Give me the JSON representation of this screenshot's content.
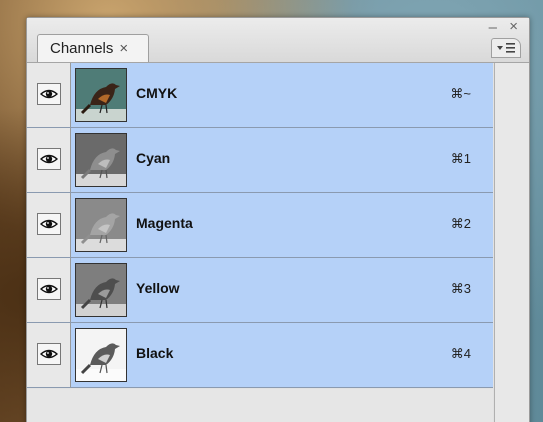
{
  "panel": {
    "tab_label": "Channels",
    "tab_close_glyph": "×",
    "minimize_glyph": "–",
    "close_glyph": "×"
  },
  "channels": [
    {
      "name": "CMYK",
      "shortcut": "⌘~",
      "thumb": "color",
      "visible": true
    },
    {
      "name": "Cyan",
      "shortcut": "⌘1",
      "thumb": "gray-dark",
      "visible": true
    },
    {
      "name": "Magenta",
      "shortcut": "⌘2",
      "thumb": "gray-mid",
      "visible": true
    },
    {
      "name": "Yellow",
      "shortcut": "⌘3",
      "thumb": "gray-mid2",
      "visible": true
    },
    {
      "name": "Black",
      "shortcut": "⌘4",
      "thumb": "gray-light",
      "visible": true
    }
  ],
  "colors": {
    "selected_row": "#b5d1f8",
    "panel_bg": "#e2e2e2"
  },
  "icons": {
    "visibility": "eye-icon",
    "panel_menu": "panel-menu-icon"
  }
}
